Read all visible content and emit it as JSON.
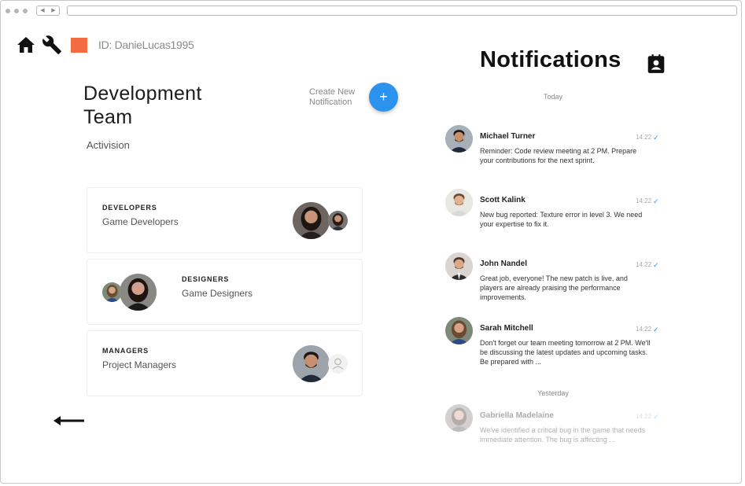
{
  "header": {
    "user_id": "ID: DanieLucas1995"
  },
  "team": {
    "title": "Development Team",
    "company": "Activision"
  },
  "create": {
    "label": "Create New Notification",
    "button_symbol": "+"
  },
  "groups": [
    {
      "kicker": "DEVELOPERS",
      "name": "Game Developers"
    },
    {
      "kicker": "DESIGNERS",
      "name": "Game Designers"
    },
    {
      "kicker": "MANAGERS",
      "name": "Project Managers"
    }
  ],
  "notifications": {
    "title": "Notifications",
    "today_label": "Today",
    "yesterday_label": "Yesterday",
    "items": [
      {
        "name": "Michael Turner",
        "time": "14:22",
        "message": "Reminder: Code review meeting at 2 PM. Prepare your contributions for the next sprint."
      },
      {
        "name": "Scott Kalink",
        "time": "14:22",
        "message": "New bug reported: Texture error in level 3. We need your expertise to fix it."
      },
      {
        "name": "John Nandel",
        "time": "14:22",
        "message": "Great job, everyone! The new patch is live, and players are already praising the performance improvements."
      },
      {
        "name": "Sarah Mitchell",
        "time": "14:22",
        "message": "Don't forget our team meeting tomorrow at 2 PM. We'll be discussing the latest updates and upcoming tasks. Be prepared with ..."
      },
      {
        "name": "Gabriella Madelaine",
        "time": "14:22",
        "message": "We've identified a critical bug in the game that needs immediate attention. The bug is affecting ..."
      }
    ]
  },
  "icons": {
    "home": "home-icon",
    "settings": "wrench-icon",
    "back": "arrow-left-icon",
    "notifications": "contact-badge-icon",
    "read": "check-icon"
  },
  "colors": {
    "accent": "#2b93ee",
    "brand_square": "#f26b43"
  }
}
